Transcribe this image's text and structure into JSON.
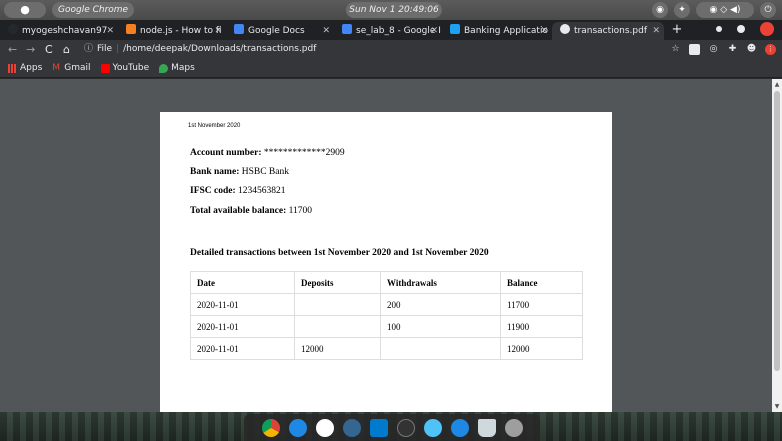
{
  "system_bar": {
    "app_name": "Google Chrome",
    "clock": "Sun Nov 1  20:49:06"
  },
  "tabs": [
    {
      "label": "myogeshchavan97",
      "favicon_color": "#24292e"
    },
    {
      "label": "node.js - How to fi",
      "favicon_color": "#f48024"
    },
    {
      "label": "Google Docs",
      "favicon_color": "#4285f4"
    },
    {
      "label": "se_lab_8 - Google I",
      "favicon_color": "#4285f4"
    },
    {
      "label": "Banking Applicatio",
      "favicon_color": "#1da1f2"
    },
    {
      "label": "transactions.pdf",
      "favicon_color": "#e8eaed",
      "active": true
    }
  ],
  "address_bar": {
    "scheme_label": "File",
    "url": "/home/deepak/Downloads/transactions.pdf"
  },
  "bookmarks": [
    {
      "label": "Apps",
      "icon": "apps-grid-icon",
      "color": "#8ab4f8"
    },
    {
      "label": "Gmail",
      "icon": "gmail-icon",
      "color": "#ea4335"
    },
    {
      "label": "YouTube",
      "icon": "youtube-icon",
      "color": "#ff0000"
    },
    {
      "label": "Maps",
      "icon": "maps-icon",
      "color": "#34a853"
    }
  ],
  "pdf": {
    "date": "1st November 2020",
    "account_number_label": "Account number:",
    "account_number": "*************2909",
    "bank_name_label": "Bank name:",
    "bank_name": "HSBC Bank",
    "ifsc_label": "IFSC code:",
    "ifsc": "1234563821",
    "balance_label": "Total available balance:",
    "balance": "11700",
    "heading": "Detailed transactions between 1st November 2020 and 1st November 2020",
    "table": {
      "headers": [
        "Date",
        "Deposits",
        "Withdrawals",
        "Balance"
      ],
      "rows": [
        [
          "2020-11-01",
          "",
          "200",
          "11700"
        ],
        [
          "2020-11-01",
          "",
          "100",
          "11900"
        ],
        [
          "2020-11-01",
          "12000",
          "",
          "12000"
        ]
      ]
    }
  },
  "dock_apps": [
    {
      "name": "chrome-icon",
      "color": "#db4437"
    },
    {
      "name": "browser-icon",
      "color": "#1e88e5"
    },
    {
      "name": "mongodb-compass-icon",
      "color": "#ffffff"
    },
    {
      "name": "postgres-icon",
      "color": "#336791"
    },
    {
      "name": "vscode-icon",
      "color": "#007acc"
    },
    {
      "name": "terminal-icon",
      "color": "#333333"
    },
    {
      "name": "weather-icon",
      "color": "#4fc3f7"
    },
    {
      "name": "app-store-icon",
      "color": "#1e88e5"
    },
    {
      "name": "trash-icon",
      "color": "#cfd8dc"
    },
    {
      "name": "system-settings-icon",
      "color": "#9e9e9e"
    }
  ]
}
